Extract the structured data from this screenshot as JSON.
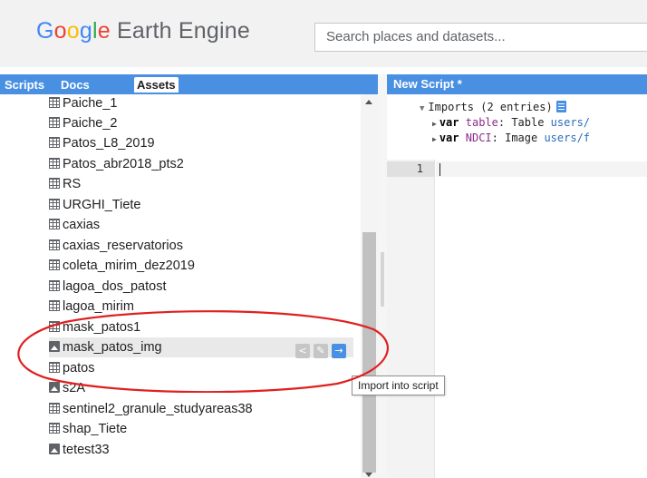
{
  "header": {
    "logo": {
      "g1": "G",
      "g2": "o",
      "g3": "o",
      "g4": "g",
      "g5": "l",
      "g6": "e",
      "rest": " Earth Engine"
    },
    "search_placeholder": "Search places and datasets..."
  },
  "left_panel": {
    "tabs": [
      {
        "label": "Scripts"
      },
      {
        "label": "Docs"
      },
      {
        "label": "Assets"
      }
    ],
    "active_tab": "Assets",
    "assets": [
      {
        "name": "Paiche_1",
        "type": "table"
      },
      {
        "name": "Paiche_2",
        "type": "table"
      },
      {
        "name": "Patos_L8_2019",
        "type": "table"
      },
      {
        "name": "Patos_abr2018_pts2",
        "type": "table"
      },
      {
        "name": "RS",
        "type": "table"
      },
      {
        "name": "URGHI_Tiete",
        "type": "table"
      },
      {
        "name": "caxias",
        "type": "table"
      },
      {
        "name": "caxias_reservatorios",
        "type": "table"
      },
      {
        "name": "coleta_mirim_dez2019",
        "type": "table"
      },
      {
        "name": "lagoa_dos_patost",
        "type": "table"
      },
      {
        "name": "lagoa_mirim",
        "type": "table"
      },
      {
        "name": "mask_patos1",
        "type": "table"
      },
      {
        "name": "mask_patos_img",
        "type": "image"
      },
      {
        "name": "patos",
        "type": "table"
      },
      {
        "name": "s2A",
        "type": "image"
      },
      {
        "name": "sentinel2_granule_studyareas38",
        "type": "table"
      },
      {
        "name": "shap_Tiete",
        "type": "table"
      },
      {
        "name": "tetest33",
        "type": "image"
      }
    ],
    "selected_asset": "mask_patos_img",
    "row_action_icons": [
      "share-icon",
      "edit-icon",
      "import-arrow-icon"
    ]
  },
  "script_panel": {
    "tab_title": "New Script *",
    "imports_header": "Imports (2 entries)",
    "imports": [
      {
        "keyword": "var",
        "name": "table",
        "rest": ": Table ",
        "path": "users/"
      },
      {
        "keyword": "var",
        "name": "NDCI",
        "rest": ": Image ",
        "path": "users/f"
      }
    ],
    "line_numbers": [
      "1"
    ]
  },
  "tooltip": {
    "text": "Import into script"
  },
  "colors": {
    "panel_header_blue": "#4a90e2",
    "annotation_red": "#e02020"
  }
}
